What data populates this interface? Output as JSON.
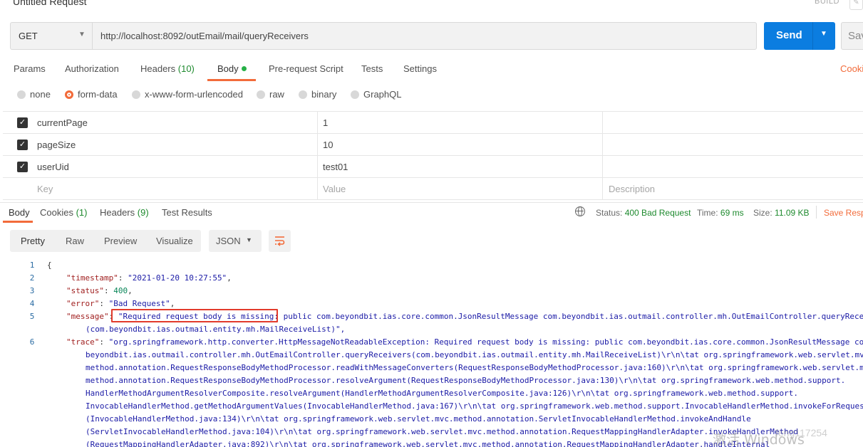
{
  "request_title": "Untitled Request",
  "build_label": "BUILD",
  "method": "GET",
  "url": "http://localhost:8092/outEmail/mail/queryReceivers",
  "send_label": "Send",
  "save_label": "Sav",
  "request_tabs": {
    "params": "Params",
    "authorization": "Authorization",
    "headers": "Headers",
    "headers_count": "(10)",
    "body": "Body",
    "prerequest": "Pre-request Script",
    "tests": "Tests",
    "settings": "Settings",
    "cookies": "Cooki"
  },
  "body_types": [
    "none",
    "form-data",
    "x-www-form-urlencoded",
    "raw",
    "binary",
    "GraphQL"
  ],
  "selected_body_type": "form-data",
  "params": [
    {
      "key": "currentPage",
      "value": "1",
      "checked": true
    },
    {
      "key": "pageSize",
      "value": "10",
      "checked": true
    },
    {
      "key": "userUid",
      "value": "test01",
      "checked": true
    }
  ],
  "params_placeholder": {
    "key": "Key",
    "value": "Value",
    "description": "Description"
  },
  "response_tabs": {
    "body": "Body",
    "cookies": "Cookies",
    "cookies_count": "(1)",
    "headers": "Headers",
    "headers_count": "(9)",
    "test_results": "Test Results"
  },
  "status": {
    "status_label": "Status:",
    "status_value": "400 Bad Request",
    "time_label": "Time:",
    "time_value": "69 ms",
    "size_label": "Size:",
    "size_value": "11.09 KB",
    "save_response": "Save Resp"
  },
  "view_modes": [
    "Pretty",
    "Raw",
    "Preview",
    "Visualize"
  ],
  "format": "JSON",
  "code": {
    "line_numbers": [
      "1",
      "2",
      "3",
      "4",
      "5",
      "6"
    ],
    "open_brace": "{",
    "timestamp_key": "\"timestamp\"",
    "timestamp_val": "\"2021-01-20 10:27:55\"",
    "status_key": "\"status\"",
    "status_val": "400",
    "error_key": "\"error\"",
    "error_val": "\"Bad Request\"",
    "message_key": "\"message\"",
    "message_highlight": "\"Required request body is missing:",
    "message_rest": " public com.beyondbit.ias.core.common.JsonResultMessage com.beyondbit.ias.outmail.controller.mh.OutEmailController.queryRece",
    "message_cont": "(com.beyondbit.ias.outmail.entity.mh.MailReceiveList)\",",
    "trace_key": "\"trace\"",
    "trace_first": "\"org.springframework.http.converter.HttpMessageNotReadableException: Required request body is missing: public com.beyondbit.ias.core.common.JsonResultMessage co",
    "trace_lines": [
      "beyondbit.ias.outmail.controller.mh.OutEmailController.queryReceivers(com.beyondbit.ias.outmail.entity.mh.MailReceiveList)\\r\\n\\tat org.springframework.web.servlet.mvc",
      "method.annotation.RequestResponseBodyMethodProcessor.readWithMessageConverters(RequestResponseBodyMethodProcessor.java:160)\\r\\n\\tat org.springframework.web.servlet.mv",
      "method.annotation.RequestResponseBodyMethodProcessor.resolveArgument(RequestResponseBodyMethodProcessor.java:130)\\r\\n\\tat org.springframework.web.method.support.",
      "HandlerMethodArgumentResolverComposite.resolveArgument(HandlerMethodArgumentResolverComposite.java:126)\\r\\n\\tat org.springframework.web.method.support.",
      "InvocableHandlerMethod.getMethodArgumentValues(InvocableHandlerMethod.java:167)\\r\\n\\tat org.springframework.web.method.support.InvocableHandlerMethod.invokeForRequest",
      "(InvocableHandlerMethod.java:134)\\r\\n\\tat org.springframework.web.servlet.mvc.method.annotation.ServletInvocableHandlerMethod.invokeAndHandle",
      "(ServletInvocableHandlerMethod.java:104)\\r\\n\\tat org.springframework.web.servlet.mvc.method.annotation.RequestMappingHandlerAdapter.invokeHandlerMethod",
      "(RequestMappingHandlerAdapter.java:892)\\r\\n\\tat org.springframework.web.servlet.mvc.method.annotation.RequestMappingHandlerAdapter.handleInternal"
    ]
  },
  "watermark": "激活 Windows",
  "watermark_user": "feng117254",
  "colors": {
    "accent": "#f26b3a",
    "send": "#0b7de0",
    "status_ok_text": "#1e8a2e",
    "highlight_box": "#e23b2c"
  }
}
